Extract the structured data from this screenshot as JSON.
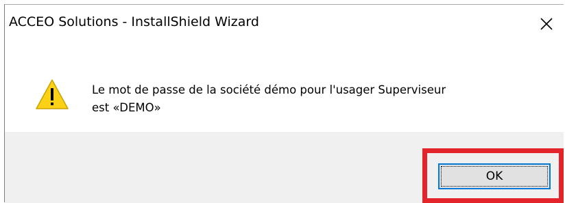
{
  "window": {
    "title": "ACCEO Solutions - InstallShield Wizard",
    "close_icon": "close-icon"
  },
  "message": {
    "icon": "warning-icon",
    "line1": "Le mot de passe de la société démo pour l'usager Superviseur",
    "line2": "est «DEMO»"
  },
  "footer": {
    "ok_label": "OK"
  },
  "colors": {
    "highlight": "#e3242b",
    "focus": "#0078d7",
    "warning": "#fcd116",
    "footer_bg": "#f0f0f0"
  }
}
